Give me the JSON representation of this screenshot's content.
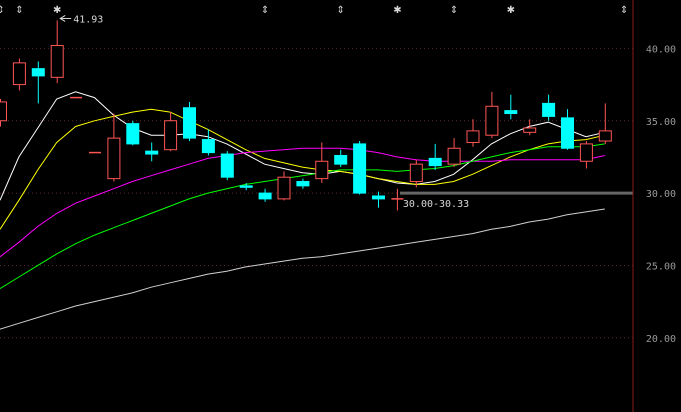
{
  "chart_data": {
    "type": "candlestick",
    "title": "",
    "xlabel": "",
    "ylabel": "",
    "ylim": [
      18,
      44
    ],
    "y_ticks": [
      "40.00",
      "35.00",
      "30.00",
      "25.00",
      "20.00"
    ],
    "grid": true,
    "colors": {
      "up": "#ff5555",
      "down": "#00ffff",
      "background": "#000000",
      "grid": "#5a2a2a",
      "axis": "#8b1a1a"
    },
    "candles": [
      {
        "o": 35.0,
        "c": 36.3,
        "h": 36.5,
        "l": 34.6
      },
      {
        "o": 37.5,
        "c": 39.0,
        "h": 39.3,
        "l": 37.1
      },
      {
        "o": 38.6,
        "c": 38.1,
        "h": 39.1,
        "l": 36.2
      },
      {
        "o": 38.0,
        "c": 40.2,
        "h": 41.93,
        "l": 37.6
      },
      {
        "o": 36.6,
        "c": 36.6,
        "h": 36.6,
        "l": 36.6
      },
      {
        "o": 32.8,
        "c": 32.8,
        "h": 32.8,
        "l": 32.8
      },
      {
        "o": 31.0,
        "c": 33.8,
        "h": 35.5,
        "l": 30.8
      },
      {
        "o": 34.8,
        "c": 33.4,
        "h": 35.0,
        "l": 33.3
      },
      {
        "o": 32.9,
        "c": 32.7,
        "h": 33.5,
        "l": 32.2
      },
      {
        "o": 33.0,
        "c": 35.0,
        "h": 35.6,
        "l": 32.9
      },
      {
        "o": 35.9,
        "c": 33.8,
        "h": 36.3,
        "l": 33.6
      },
      {
        "o": 33.7,
        "c": 32.8,
        "h": 34.4,
        "l": 32.6
      },
      {
        "o": 32.7,
        "c": 31.1,
        "h": 32.9,
        "l": 30.9
      },
      {
        "o": 30.5,
        "c": 30.4,
        "h": 30.7,
        "l": 30.2
      },
      {
        "o": 30.0,
        "c": 29.6,
        "h": 30.3,
        "l": 29.4
      },
      {
        "o": 29.6,
        "c": 31.1,
        "h": 31.5,
        "l": 29.5
      },
      {
        "o": 30.8,
        "c": 30.5,
        "h": 31.0,
        "l": 30.3
      },
      {
        "o": 31.0,
        "c": 32.2,
        "h": 33.5,
        "l": 30.7
      },
      {
        "o": 32.6,
        "c": 32.0,
        "h": 33.0,
        "l": 31.8
      },
      {
        "o": 33.4,
        "c": 30.0,
        "h": 33.6,
        "l": 29.9
      },
      {
        "o": 29.8,
        "c": 29.6,
        "h": 30.1,
        "l": 29.0
      },
      {
        "o": 29.6,
        "c": 29.6,
        "h": 30.3,
        "l": 28.8
      },
      {
        "o": 30.8,
        "c": 32.0,
        "h": 32.3,
        "l": 30.4
      },
      {
        "o": 32.4,
        "c": 31.9,
        "h": 33.4,
        "l": 31.6
      },
      {
        "o": 32.0,
        "c": 33.1,
        "h": 33.8,
        "l": 31.8
      },
      {
        "o": 33.5,
        "c": 34.3,
        "h": 35.1,
        "l": 33.2
      },
      {
        "o": 34.0,
        "c": 36.0,
        "h": 37.0,
        "l": 33.8
      },
      {
        "o": 35.7,
        "c": 35.5,
        "h": 36.8,
        "l": 35.1
      },
      {
        "o": 34.2,
        "c": 34.5,
        "h": 35.1,
        "l": 34.0
      },
      {
        "o": 36.2,
        "c": 35.3,
        "h": 36.8,
        "l": 35.0
      },
      {
        "o": 35.2,
        "c": 33.1,
        "h": 35.8,
        "l": 33.0
      },
      {
        "o": 32.2,
        "c": 33.4,
        "h": 33.6,
        "l": 31.7
      },
      {
        "o": 33.6,
        "c": 34.3,
        "h": 36.2,
        "l": 33.4
      }
    ],
    "series": [
      {
        "color": "#ffffff",
        "values": [
          29.5,
          32.5,
          34.5,
          36.5,
          37.0,
          36.6,
          35.4,
          34.5,
          34.0,
          34.0,
          34.1,
          33.9,
          33.4,
          32.7,
          32.0,
          31.7,
          31.4,
          31.3,
          31.5,
          31.3,
          31.0,
          30.7,
          30.6,
          30.8,
          31.3,
          32.3,
          33.4,
          34.1,
          34.6,
          34.9,
          34.4,
          33.9,
          34.2
        ]
      },
      {
        "color": "#ffff00",
        "values": [
          27.5,
          29.5,
          31.6,
          33.5,
          34.6,
          35.0,
          35.3,
          35.6,
          35.8,
          35.6,
          35.0,
          34.4,
          33.7,
          33.0,
          32.4,
          32.1,
          31.8,
          31.6,
          31.5,
          31.3,
          31.0,
          30.8,
          30.6,
          30.6,
          30.8,
          31.3,
          31.9,
          32.5,
          33.0,
          33.4,
          33.6,
          33.7,
          34.0
        ]
      },
      {
        "color": "#ff00ff",
        "values": [
          25.6,
          26.6,
          27.7,
          28.6,
          29.3,
          29.8,
          30.3,
          30.8,
          31.2,
          31.6,
          32.0,
          32.4,
          32.6,
          32.8,
          32.9,
          33.0,
          33.1,
          33.1,
          33.1,
          33.0,
          32.8,
          32.5,
          32.3,
          32.2,
          32.2,
          32.2,
          32.2,
          32.3,
          32.3,
          32.3,
          32.3,
          32.3,
          32.6
        ]
      },
      {
        "color": "#00ff00",
        "values": [
          23.4,
          24.2,
          25.0,
          25.8,
          26.5,
          27.1,
          27.6,
          28.1,
          28.6,
          29.1,
          29.6,
          30.0,
          30.3,
          30.6,
          30.8,
          31.0,
          31.2,
          31.4,
          31.6,
          31.6,
          31.6,
          31.5,
          31.6,
          31.7,
          31.9,
          32.2,
          32.5,
          32.8,
          33.0,
          33.2,
          33.2,
          33.2,
          33.4
        ]
      },
      {
        "color": "#d0d0d0",
        "values": [
          20.6,
          21.0,
          21.4,
          21.8,
          22.2,
          22.5,
          22.8,
          23.1,
          23.5,
          23.8,
          24.1,
          24.4,
          24.6,
          24.9,
          25.1,
          25.3,
          25.5,
          25.6,
          25.8,
          26.0,
          26.2,
          26.4,
          26.6,
          26.8,
          27.0,
          27.2,
          27.5,
          27.7,
          28.0,
          28.2,
          28.5,
          28.7,
          28.9
        ]
      }
    ],
    "annotations": {
      "high_label": "41.93",
      "range_label": "30.00-30.33"
    },
    "event_markers": [
      {
        "index": 0,
        "symbol": "⇕"
      },
      {
        "index": 1,
        "symbol": "⇕"
      },
      {
        "index": 3,
        "symbol": "✱"
      },
      {
        "index": 14,
        "symbol": "⇕"
      },
      {
        "index": 18,
        "symbol": "⇕"
      },
      {
        "index": 21,
        "symbol": "✱"
      },
      {
        "index": 24,
        "symbol": "⇕"
      },
      {
        "index": 27,
        "symbol": "✱"
      },
      {
        "index": 33,
        "symbol": "⇕"
      }
    ]
  }
}
